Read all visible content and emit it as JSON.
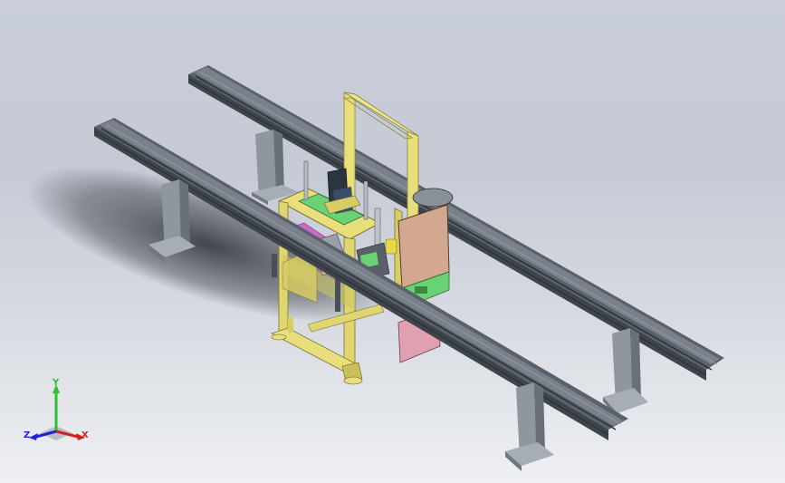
{
  "viewport": {
    "background_top": "#c9ced8",
    "background_bottom": "#eef0f3"
  },
  "model": {
    "frame_color": "#e8de7a",
    "rail_color": "#5e656e",
    "leg_color": "#8f969d",
    "panel_orange": "#d2a890",
    "panel_green": "#6ad274",
    "panel_pink": "#e0a0b0",
    "panel_gray": "#9aa0a8"
  },
  "triad": {
    "y_label": "Y",
    "x_label": "X",
    "z_label": "Z",
    "y_color": "#2fbf2f",
    "x_color": "#d42020",
    "z_color": "#2020d4"
  }
}
